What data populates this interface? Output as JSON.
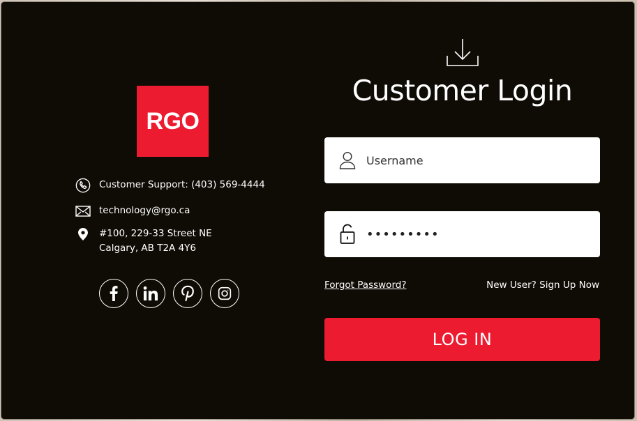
{
  "brand": {
    "logo_text": "RGO",
    "accent_color": "#ec1b30",
    "panel_color": "#0f0b05"
  },
  "contact": {
    "phone_icon": "phone-icon",
    "support_text": "Customer Support: (403) 569-4444",
    "email_icon": "mail-icon",
    "email_text": "technology@rgo.ca",
    "location_icon": "map-pin-icon",
    "address_line1": "#100, 229-33 Street NE",
    "address_line2": "Calgary, AB T2A 4Y6"
  },
  "socials": [
    {
      "name": "facebook",
      "icon": "facebook-icon"
    },
    {
      "name": "linkedin",
      "icon": "linkedin-icon"
    },
    {
      "name": "pinterest",
      "icon": "pinterest-icon"
    },
    {
      "name": "instagram",
      "icon": "instagram-icon"
    }
  ],
  "login": {
    "header_icon": "download-icon",
    "title": "Customer Login",
    "username_placeholder": "Username",
    "username_value": "",
    "password_value": "password1",
    "forgot_label": "Forgot Password?",
    "signup_label": "New User? Sign Up Now",
    "button_label": "LOG IN"
  }
}
